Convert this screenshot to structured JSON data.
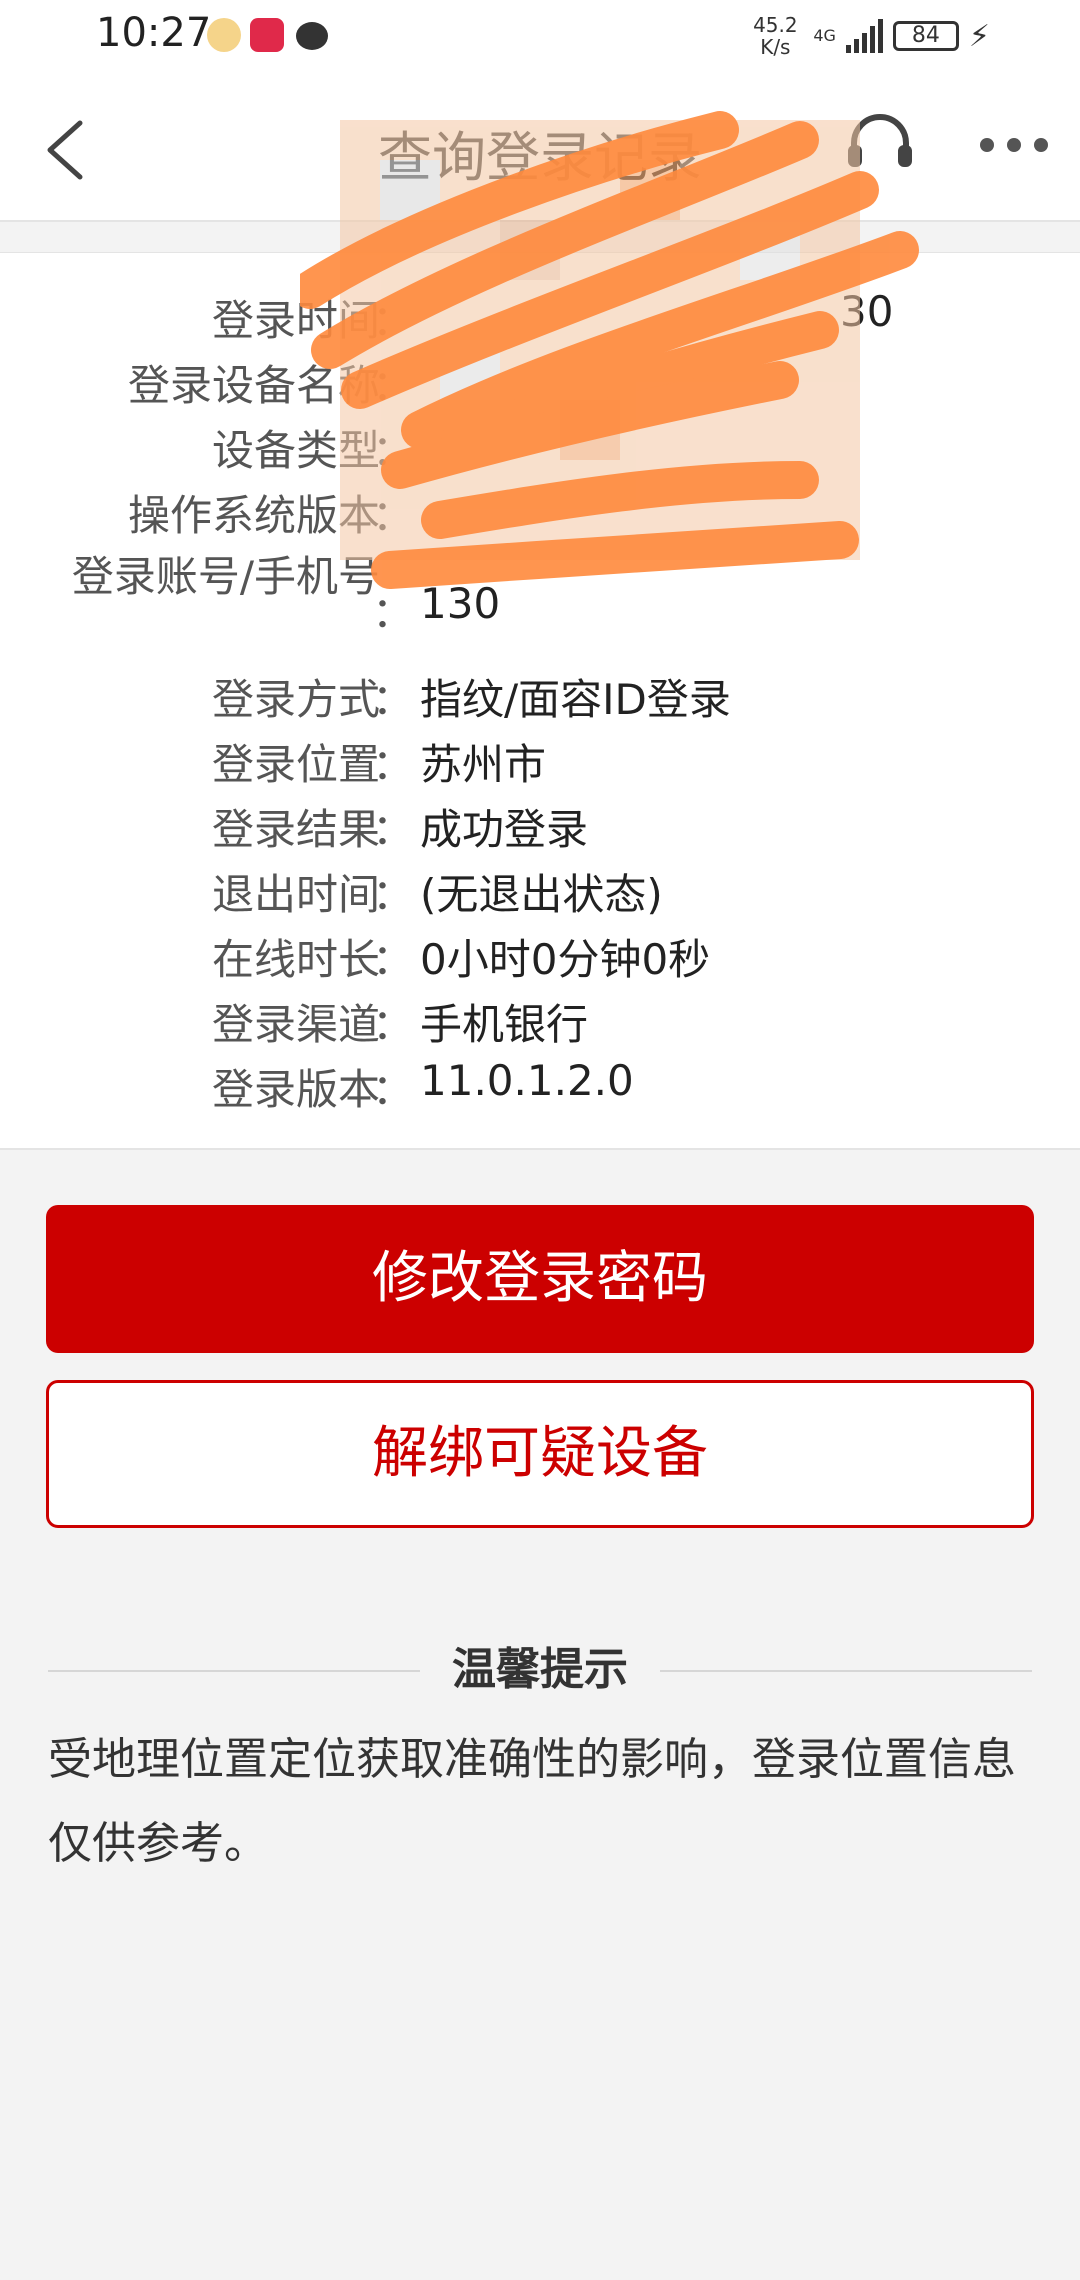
{
  "status_bar": {
    "time": "10:27",
    "net_speed_value": "45.2",
    "net_speed_unit": "K/s",
    "network": "4G",
    "battery": "84"
  },
  "nav": {
    "title": "查询登录记录"
  },
  "info": {
    "rows": [
      {
        "label": "登录时间",
        "value": "30"
      },
      {
        "label": "登录设备名称",
        "value": ""
      },
      {
        "label": "设备类型",
        "value": ""
      },
      {
        "label": "操作系统版本",
        "value": ""
      },
      {
        "label": "登录账号/手机号",
        "value": "130"
      },
      {
        "label": "登录方式",
        "value": "指纹/面容ID登录"
      },
      {
        "label": "登录位置",
        "value": "苏州市"
      },
      {
        "label": "登录结果",
        "value": "成功登录"
      },
      {
        "label": "退出时间",
        "value": "(无退出状态)"
      },
      {
        "label": "在线时长",
        "value": "0小时0分钟0秒"
      },
      {
        "label": "登录渠道",
        "value": "手机银行"
      },
      {
        "label": "登录版本",
        "value": "11.0.1.2.0"
      }
    ],
    "separator": "："
  },
  "buttons": {
    "change_password": "修改登录密码",
    "unbind_device": "解绑可疑设备"
  },
  "tips": {
    "title": "温馨提示",
    "body": "受地理位置定位获取准确性的影响，登录位置信息仅供参考。"
  },
  "colors": {
    "accent": "#cc0000",
    "background": "#f3f3f3"
  }
}
